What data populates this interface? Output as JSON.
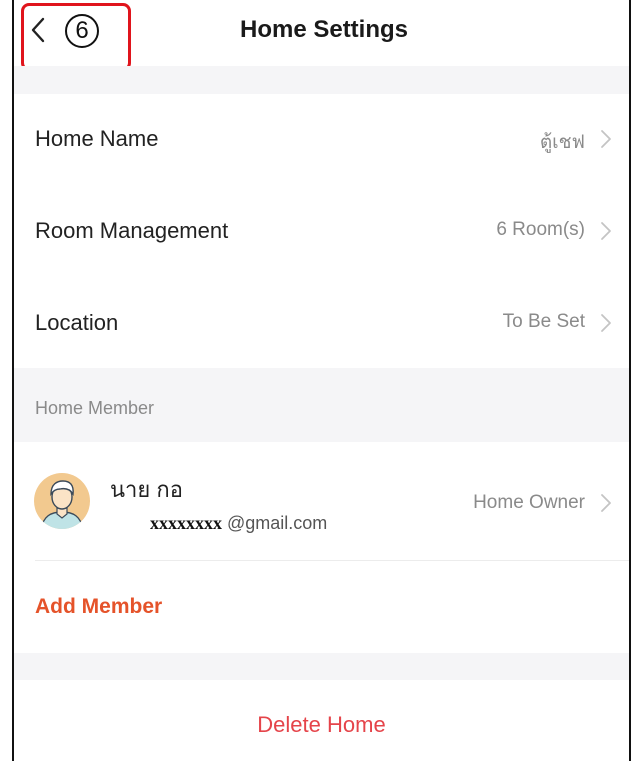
{
  "header": {
    "title": "Home Settings",
    "back_icon": "chevron-left-icon",
    "step_marker": "6"
  },
  "settings": [
    {
      "label": "Home Name",
      "value": "ตู้เชฟ"
    },
    {
      "label": "Room Management",
      "value": "6 Room(s)"
    },
    {
      "label": "Location",
      "value": "To Be Set"
    }
  ],
  "members_section": {
    "title": "Home Member",
    "members": [
      {
        "name": "นาย กอ",
        "email_masked": "xxxxxxxx",
        "email_domain": " @gmail.com",
        "role": "Home Owner"
      }
    ],
    "add_label": "Add Member"
  },
  "delete_label": "Delete Home",
  "colors": {
    "accent": "#e5532a",
    "danger": "#e5444a",
    "highlight": "#e0141c",
    "gap": "#f5f5f7"
  }
}
